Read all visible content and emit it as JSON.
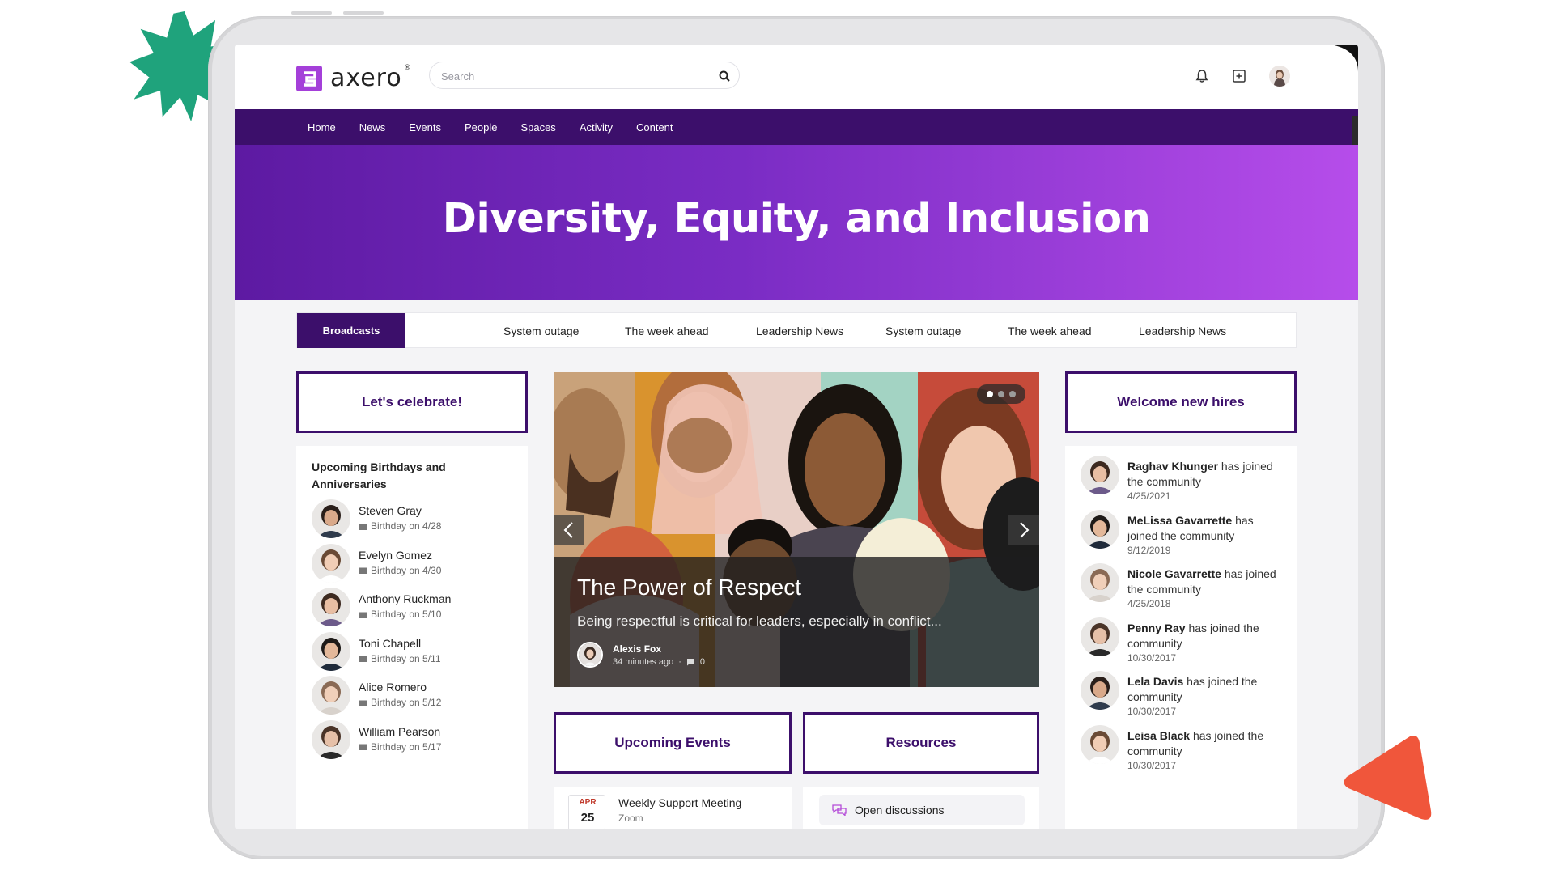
{
  "app": {
    "brand": "axero",
    "brand_mark": "®"
  },
  "search": {
    "placeholder": "Search"
  },
  "header_icons": [
    "bell-icon",
    "plus-square-icon",
    "user-avatar"
  ],
  "nav": {
    "items": [
      "Home",
      "News",
      "Events",
      "People",
      "Spaces",
      "Activity",
      "Content"
    ]
  },
  "hero": {
    "title": "Diversity, Equity, and Inclusion"
  },
  "tabs": {
    "active": "Broadcasts",
    "items": [
      "System outage",
      "The week ahead",
      "Leadership News",
      "System outage",
      "The week ahead",
      "Leadership News"
    ]
  },
  "celebrate": {
    "title": "Let's celebrate!",
    "heading": "Upcoming Birthdays and Anniversaries",
    "people": [
      {
        "name": "Steven Gray",
        "note": "Birthday on 4/28"
      },
      {
        "name": "Evelyn Gomez",
        "note": "Birthday on 4/30"
      },
      {
        "name": "Anthony Ruckman",
        "note": "Birthday on 5/10"
      },
      {
        "name": "Toni Chapell",
        "note": "Birthday on 5/11"
      },
      {
        "name": "Alice Romero",
        "note": "Birthday on 5/12"
      },
      {
        "name": "William Pearson",
        "note": "Birthday on 5/17"
      }
    ]
  },
  "carousel": {
    "title": "The Power of Respect",
    "description": "Being respectful is critical for leaders, especially in conflict...",
    "author": "Alexis Fox",
    "time": "34 minutes ago",
    "separator": "·",
    "comments": "0",
    "slide_count": 3,
    "active_slide": 1
  },
  "events": {
    "title": "Upcoming Events",
    "items": [
      {
        "month": "APR",
        "day": "25",
        "title": "Weekly Support Meeting",
        "location": "Zoom"
      }
    ]
  },
  "resources": {
    "title": "Resources",
    "items": [
      {
        "label": "Open discussions"
      }
    ]
  },
  "hires": {
    "title": "Welcome new hires",
    "suffix": "has joined the community",
    "people": [
      {
        "name": "Raghav Khunger",
        "date": "4/25/2021"
      },
      {
        "name": "MeLissa Gavarrette",
        "date": "9/12/2019"
      },
      {
        "name": "Nicole Gavarrette",
        "date": "4/25/2018"
      },
      {
        "name": "Penny Ray",
        "date": "10/30/2017"
      },
      {
        "name": "Lela Davis",
        "date": "10/30/2017"
      },
      {
        "name": "Leisa Black",
        "date": "10/30/2017"
      }
    ]
  },
  "colors": {
    "brand": "#3c0f6b",
    "accent": "#b64dea",
    "burst": "#1fa37c",
    "triangle": "#f0563b"
  }
}
